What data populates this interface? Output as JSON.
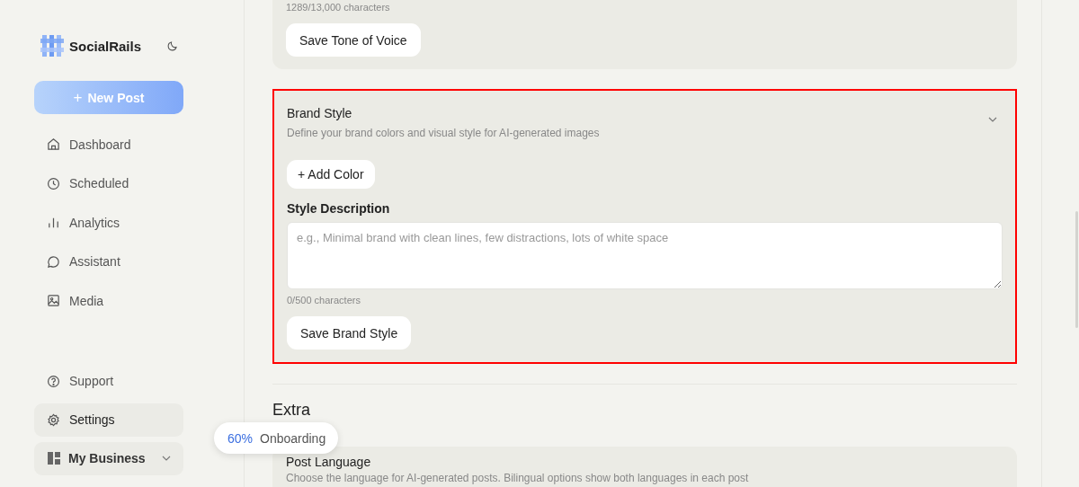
{
  "sidebar": {
    "brand": "SocialRails",
    "new_post": {
      "icon": "+",
      "label": "New Post"
    },
    "items": [
      {
        "kind": "home",
        "label": "Dashboard",
        "selected": false
      },
      {
        "kind": "clock",
        "label": "Scheduled",
        "selected": false
      },
      {
        "kind": "chart",
        "label": "Analytics",
        "selected": false
      },
      {
        "kind": "chat",
        "label": "Assistant",
        "selected": false
      },
      {
        "kind": "image",
        "label": "Media",
        "selected": false
      }
    ],
    "bottom_items": [
      {
        "kind": "help",
        "label": "Support",
        "selected": false
      },
      {
        "kind": "gear",
        "label": "Settings",
        "selected": true
      }
    ],
    "workspace": {
      "label": "My Business"
    }
  },
  "onboarding": {
    "percent": "60%",
    "label": "Onboarding"
  },
  "tone_card": {
    "counter": "1289/13,000 characters",
    "button": "Save Tone of Voice"
  },
  "brand_card": {
    "title": "Brand Style",
    "subtitle": "Define your brand colors and visual style for AI-generated images",
    "highlighted": true,
    "expanded": true,
    "add_color": "+ Add Color",
    "field_label": "Style Description",
    "placeholder": "e.g., Minimal brand with clean lines, few distractions, lots of white space",
    "counter": "0/500 characters",
    "button": "Save Brand Style"
  },
  "extra": {
    "heading": "Extra",
    "card": {
      "title": "Post Language",
      "description": "Choose the language for AI-generated posts. Bilingual options show both languages in each post"
    }
  }
}
